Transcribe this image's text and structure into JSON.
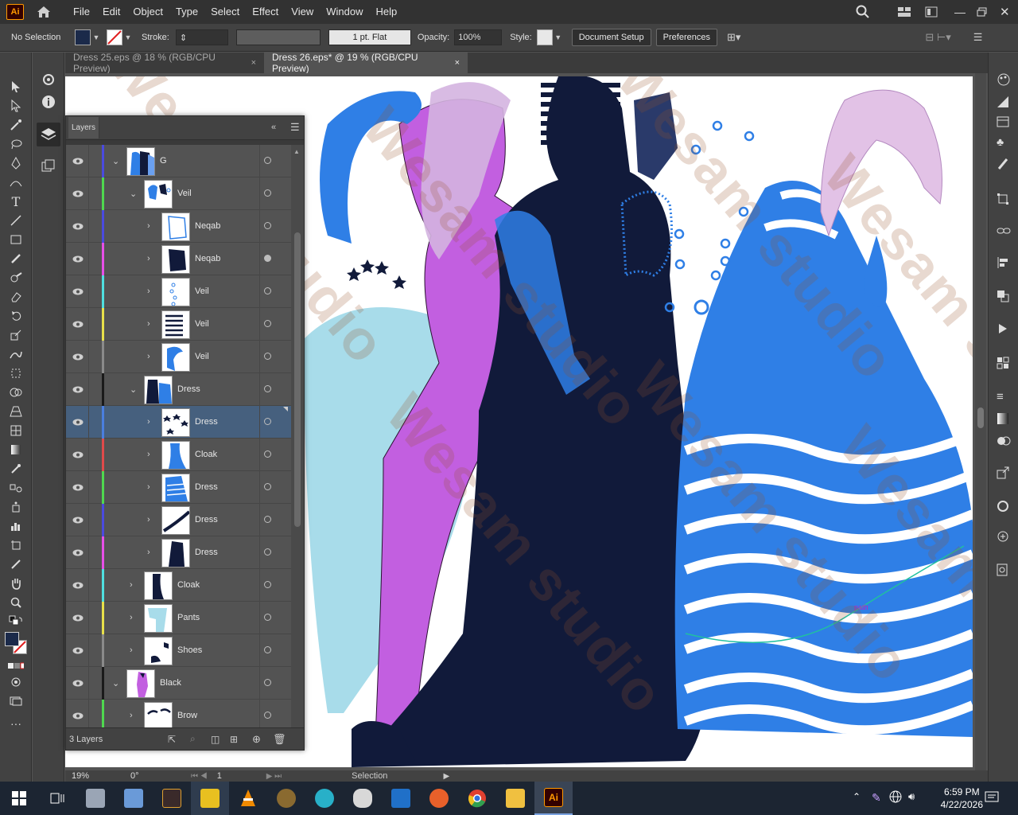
{
  "app": {
    "logo": "Ai"
  },
  "menu": [
    "File",
    "Edit",
    "Object",
    "Type",
    "Select",
    "Effect",
    "View",
    "Window",
    "Help"
  ],
  "control": {
    "selection": "No Selection",
    "stroke_label": "Stroke:",
    "brush": "1 pt. Flat",
    "opacity_label": "Opacity:",
    "opacity": "100%",
    "style_label": "Style:",
    "document_setup": "Document Setup",
    "preferences": "Preferences"
  },
  "tabs": [
    {
      "title": "Dress 25.eps @ 18 % (RGB/CPU Preview)",
      "close": "×"
    },
    {
      "title": "Dress 26.eps* @ 19 % (RGB/CPU Preview)",
      "close": "×"
    }
  ],
  "layers_panel": {
    "title": "Layers",
    "count": "3 Layers",
    "rows": [
      {
        "name": "G",
        "color": "#4a4adf"
      },
      {
        "name": "Veil",
        "color": "#4fd84f"
      },
      {
        "name": "Neqab",
        "color": "#4a4adf"
      },
      {
        "name": "Neqab",
        "color": "#e74fe7"
      },
      {
        "name": "Veil",
        "color": "#4fe0e0"
      },
      {
        "name": "Veil",
        "color": "#e8e04a"
      },
      {
        "name": "Veil",
        "color": "#8a8a8a"
      },
      {
        "name": "Dress",
        "color": "#1a1a1a"
      },
      {
        "name": "Dress",
        "color": "#4a7fe0"
      },
      {
        "name": "Cloak",
        "color": "#e04a4a"
      },
      {
        "name": "Dress",
        "color": "#4fd84f"
      },
      {
        "name": "Dress",
        "color": "#4a4adf"
      },
      {
        "name": "Dress",
        "color": "#e74fe7"
      },
      {
        "name": "Cloak",
        "color": "#4fe0e0"
      },
      {
        "name": "Pants",
        "color": "#e8e04a"
      },
      {
        "name": "Shoes",
        "color": "#8a8a8a"
      },
      {
        "name": "Black",
        "color": "#1a1a1a"
      },
      {
        "name": "Brow",
        "color": "#4fd84f"
      }
    ]
  },
  "status": {
    "zoom": "19%",
    "rotation": "0°",
    "artboard": "1",
    "tool": "Selection"
  },
  "canvas": {
    "path_label": "path",
    "watermark": "Wesam studio"
  },
  "taskbar": {
    "time": "6:59 PM",
    "date": "4/22/2026"
  },
  "colors": {
    "fill": "#1b2a4a",
    "accent_blue": "#2f7fe6",
    "navy": "#111a3a",
    "purple": "#c25fe0",
    "light_blue": "#a8dcea"
  }
}
